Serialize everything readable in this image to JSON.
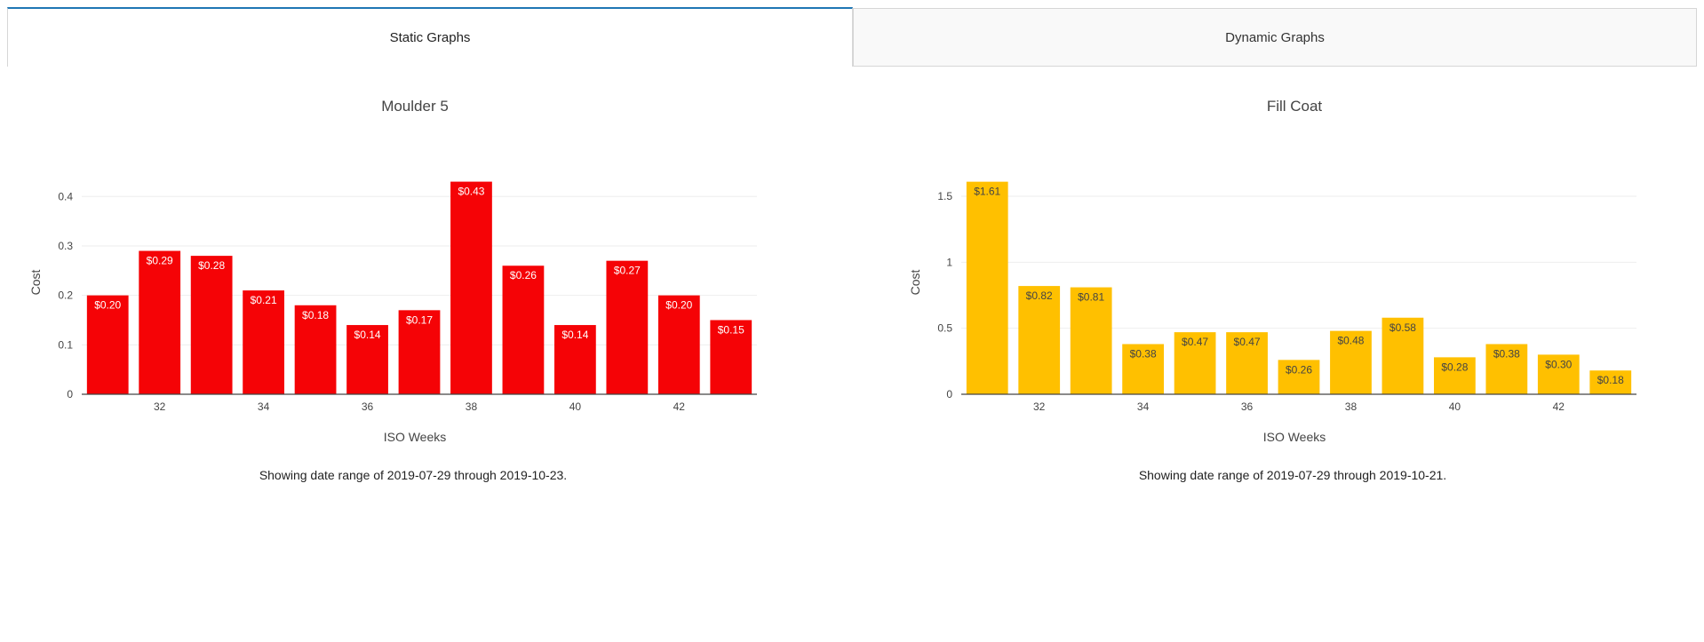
{
  "tabs": [
    {
      "label": "Static Graphs",
      "active": true
    },
    {
      "label": "Dynamic Graphs",
      "active": false
    }
  ],
  "charts": [
    {
      "caption": "Showing date range of 2019-07-29 through 2019-10-23."
    },
    {
      "caption": "Showing date range of 2019-07-29 through 2019-10-21."
    }
  ],
  "chart_data": [
    {
      "type": "bar",
      "title": "Moulder 5",
      "xlabel": "ISO Weeks",
      "ylabel": "Cost",
      "x": [
        31,
        32,
        33,
        34,
        35,
        36,
        37,
        38,
        39,
        40,
        41,
        42,
        43
      ],
      "values": [
        0.2,
        0.29,
        0.28,
        0.21,
        0.18,
        0.14,
        0.17,
        0.43,
        0.26,
        0.14,
        0.27,
        0.2,
        0.15
      ],
      "labels": [
        "$0.20",
        "$0.29",
        "$0.28",
        "$0.21",
        "$0.18",
        "$0.14",
        "$0.17",
        "$0.43",
        "$0.26",
        "$0.14",
        "$0.27",
        "$0.20",
        "$0.15"
      ],
      "xticks": [
        32,
        34,
        36,
        38,
        40,
        42
      ],
      "yticks": [
        0,
        0.1,
        0.2,
        0.3,
        0.4
      ],
      "ytick_labels": [
        "0",
        "0.1",
        "0.2",
        "0.3",
        "0.4"
      ],
      "ylim": [
        0,
        0.4526
      ],
      "color": "#f50306",
      "label_color": "#ffffff",
      "grid": true
    },
    {
      "type": "bar",
      "title": "Fill Coat",
      "xlabel": "ISO Weeks",
      "ylabel": "Cost",
      "x": [
        31,
        32,
        33,
        34,
        35,
        36,
        37,
        38,
        39,
        40,
        41,
        42,
        43
      ],
      "values": [
        1.61,
        0.82,
        0.81,
        0.38,
        0.47,
        0.47,
        0.26,
        0.48,
        0.58,
        0.28,
        0.38,
        0.3,
        0.18
      ],
      "labels": [
        "$1.61",
        "$0.82",
        "$0.81",
        "$0.38",
        "$0.47",
        "$0.47",
        "$0.26",
        "$0.48",
        "$0.58",
        "$0.28",
        "$0.38",
        "$0.30",
        "$0.18"
      ],
      "xticks": [
        32,
        34,
        36,
        38,
        40,
        42
      ],
      "yticks": [
        0,
        0.5,
        1,
        1.5
      ],
      "ytick_labels": [
        "0",
        "0.5",
        "1",
        "1.5"
      ],
      "ylim": [
        0,
        1.695
      ],
      "color": "#ffc000",
      "label_color": "#444444",
      "grid": true
    }
  ]
}
